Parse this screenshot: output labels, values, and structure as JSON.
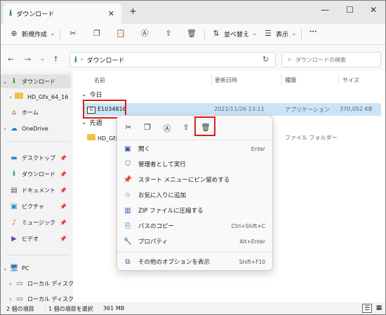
{
  "window": {
    "tab_title": "ダウンロード",
    "tab_close": "✕",
    "new_tab": "+",
    "minimize": "—",
    "maximize": "☐",
    "close": "✕"
  },
  "toolbar": {
    "new_label": "新規作成",
    "sort_label": "並べ替え",
    "view_label": "表示",
    "more_label": "···"
  },
  "address": {
    "path": "ダウンロード",
    "search_placeholder": "ダウンロードの検索"
  },
  "sidebar": {
    "items": [
      {
        "label": "ダウンロード",
        "icon": "download-icon",
        "selected": true
      },
      {
        "label": "HD_Gfx_64_16",
        "icon": "folder-icon"
      },
      {
        "label": "ホーム",
        "icon": "home-icon"
      },
      {
        "label": "OneDrive",
        "icon": "cloud-icon"
      },
      {
        "label": "デスクトップ",
        "icon": "desktop-icon"
      },
      {
        "label": "ダウンロード",
        "icon": "download-icon"
      },
      {
        "label": "ドキュメント",
        "icon": "document-icon"
      },
      {
        "label": "ピクチャ",
        "icon": "picture-icon"
      },
      {
        "label": "ミュージック",
        "icon": "music-icon"
      },
      {
        "label": "ビデオ",
        "icon": "video-icon"
      },
      {
        "label": "PC",
        "icon": "pc-icon"
      },
      {
        "label": "ローカル ディスク",
        "icon": "disk-icon"
      },
      {
        "label": "ローカル ディスク",
        "icon": "disk-icon"
      }
    ]
  },
  "columns": {
    "name": "名前",
    "date": "更新日時",
    "type": "種類",
    "size": "サイズ"
  },
  "groups": {
    "today": "今日",
    "last_week": "先週"
  },
  "files": {
    "selected": {
      "name": "E1034816",
      "date": "2022/11/26 13:11",
      "type": "アプリケーション",
      "size": "370,052 KB"
    },
    "folder": {
      "name": "HD_Gfx",
      "type": "ファイル フォルダー"
    }
  },
  "context_menu": {
    "items": [
      {
        "label": "開く",
        "shortcut": "Enter",
        "icon": "open-icon"
      },
      {
        "label": "管理者として実行",
        "shortcut": "",
        "icon": "shield-icon"
      },
      {
        "label": "スタート メニューにピン留めする",
        "shortcut": "",
        "icon": "pin-icon"
      },
      {
        "label": "お気に入りに追加",
        "shortcut": "",
        "icon": "star-icon"
      },
      {
        "label": "ZIP ファイルに圧縮する",
        "shortcut": "",
        "icon": "zip-icon"
      },
      {
        "label": "パスのコピー",
        "shortcut": "Ctrl+Shift+C",
        "icon": "copy-path-icon"
      },
      {
        "label": "プロパティ",
        "shortcut": "Alt+Enter",
        "icon": "wrench-icon"
      },
      {
        "label": "その他のオプションを表示",
        "shortcut": "Shift+F10",
        "icon": "more-options-icon"
      }
    ]
  },
  "status": {
    "count": "2 個の項目",
    "selection": "1 個の項目を選択",
    "size": "361 MB"
  },
  "colors": {
    "highlight": "#e01b1b",
    "selection": "#cce4f7",
    "accent": "#2b57a8"
  }
}
